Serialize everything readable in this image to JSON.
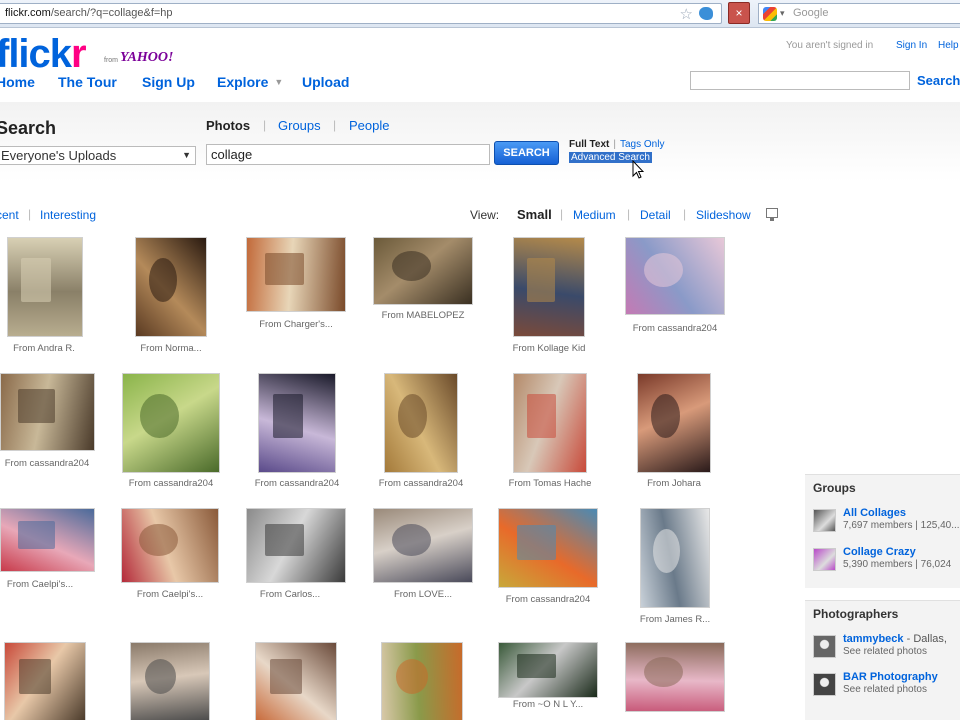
{
  "browser": {
    "url_host": "flickr.com",
    "url_path": "/search/?q=collage&f=hp",
    "search_placeholder": "Google",
    "stop_symbol": "×"
  },
  "header": {
    "logo_a": "flick",
    "logo_b": "r",
    "logo_from": "from",
    "logo_yahoo": "YAHOO!",
    "signed_in_text": "You aren't signed in",
    "sign_in": "Sign In",
    "help": "Help",
    "nav": [
      "Home",
      "The Tour",
      "Sign Up",
      "Explore",
      "Upload"
    ],
    "search_button": "Search"
  },
  "search": {
    "title": "Search",
    "filters": [
      "Photos",
      "Groups",
      "People"
    ],
    "scope": "Everyone's Uploads",
    "query": "collage",
    "button": "SEARCH",
    "full_text": "Full Text",
    "tags_only": "Tags Only",
    "advanced": "Advanced Search"
  },
  "view": {
    "sort": [
      "cent",
      "Interesting"
    ],
    "label": "View:",
    "active": "Small",
    "options": [
      "Medium",
      "Detail",
      "Slideshow"
    ]
  },
  "photos": [
    {
      "caption": "From Andra R.",
      "colors": [
        "#b8ad8f",
        "#8a8068",
        "#d8d0b4"
      ]
    },
    {
      "caption": "From Norma...",
      "colors": [
        "#5a3a22",
        "#b48a5a",
        "#2a1a10"
      ]
    },
    {
      "caption": "From Charger's...",
      "colors": [
        "#c26a3a",
        "#e8d6b8",
        "#7a4a2a"
      ]
    },
    {
      "caption": "From MABELOPEZ",
      "colors": [
        "#6b5a3a",
        "#a48c6a",
        "#3a3022"
      ]
    },
    {
      "caption": "From Kollage Kid",
      "colors": [
        "#7a4a3a",
        "#3a4a6a",
        "#b48a4a"
      ]
    },
    {
      "caption": "From cassandra204",
      "colors": [
        "#c47ab4",
        "#8a9ac8",
        "#e8c8d8"
      ]
    },
    {
      "caption": "From cassandra204",
      "colors": [
        "#8a6a4a",
        "#c8b898",
        "#4a3a2a"
      ]
    },
    {
      "caption": "From cassandra204",
      "colors": [
        "#8ab44a",
        "#c8d88a",
        "#4a6a2a"
      ]
    },
    {
      "caption": "From cassandra204",
      "colors": [
        "#5a4a8a",
        "#c8b8d8",
        "#1a1a2a"
      ]
    },
    {
      "caption": "From cassandra204",
      "colors": [
        "#a47a3a",
        "#d8b87a",
        "#6a4a2a"
      ]
    },
    {
      "caption": "From Tomas Hache",
      "colors": [
        "#b48a6a",
        "#d8c8b8",
        "#c84a3a"
      ]
    },
    {
      "caption": "From Johara",
      "colors": [
        "#7a3a2a",
        "#d89a7a",
        "#2a1a1a"
      ]
    },
    {
      "caption": "From Caelpi's...",
      "colors": [
        "#c83a4a",
        "#e8a8b8",
        "#4a6a9a"
      ]
    },
    {
      "caption": "From Caelpi's...",
      "colors": [
        "#b42a3a",
        "#e8c8a8",
        "#8a5a3a"
      ]
    },
    {
      "caption": "From Carlos...",
      "colors": [
        "#8a8a8a",
        "#d8d8d8",
        "#3a3a3a"
      ]
    },
    {
      "caption": "From LOVE...",
      "colors": [
        "#9a8a7a",
        "#d8d0c8",
        "#4a4a5a"
      ]
    },
    {
      "caption": "From cassandra204",
      "colors": [
        "#c8a83a",
        "#e86a2a",
        "#4a8ab4"
      ]
    },
    {
      "caption": "From James R...",
      "colors": [
        "#c8d0d8",
        "#6a7a8a",
        "#e8e8e8"
      ]
    },
    {
      "caption": "",
      "colors": [
        "#c84a3a",
        "#e8c8a8",
        "#4a3a2a"
      ]
    },
    {
      "caption": "",
      "colors": [
        "#8a7a6a",
        "#d8c8b8",
        "#4a4a4a"
      ]
    },
    {
      "caption": "",
      "colors": [
        "#c86a3a",
        "#e8d8c8",
        "#6a4a3a"
      ]
    },
    {
      "caption": "",
      "colors": [
        "#d8c8a8",
        "#8a9a4a",
        "#c86a2a"
      ]
    },
    {
      "caption": "From ~O N L Y...",
      "colors": [
        "#3a5a3a",
        "#c8c8c8",
        "#1a2a1a"
      ]
    },
    {
      "caption": "",
      "colors": [
        "#c85a7a",
        "#e8b8c8",
        "#8a6a5a"
      ]
    }
  ],
  "sidebar": {
    "groups_title": "Groups",
    "groups": [
      {
        "name": "All Collages",
        "sub": "7,697 members | 125,40...",
        "color": "#555"
      },
      {
        "name": "Collage Crazy",
        "sub": "5,390 members | 76,024",
        "color": "#b84ac8"
      }
    ],
    "photographers_title": "Photographers",
    "photographers": [
      {
        "name": "tammybeck",
        "place": " - Dallas,",
        "sub": "See related photos",
        "color": "#666"
      },
      {
        "name": "BAR Photography",
        "place": "",
        "sub": "See related photos",
        "color": "#444"
      }
    ]
  }
}
